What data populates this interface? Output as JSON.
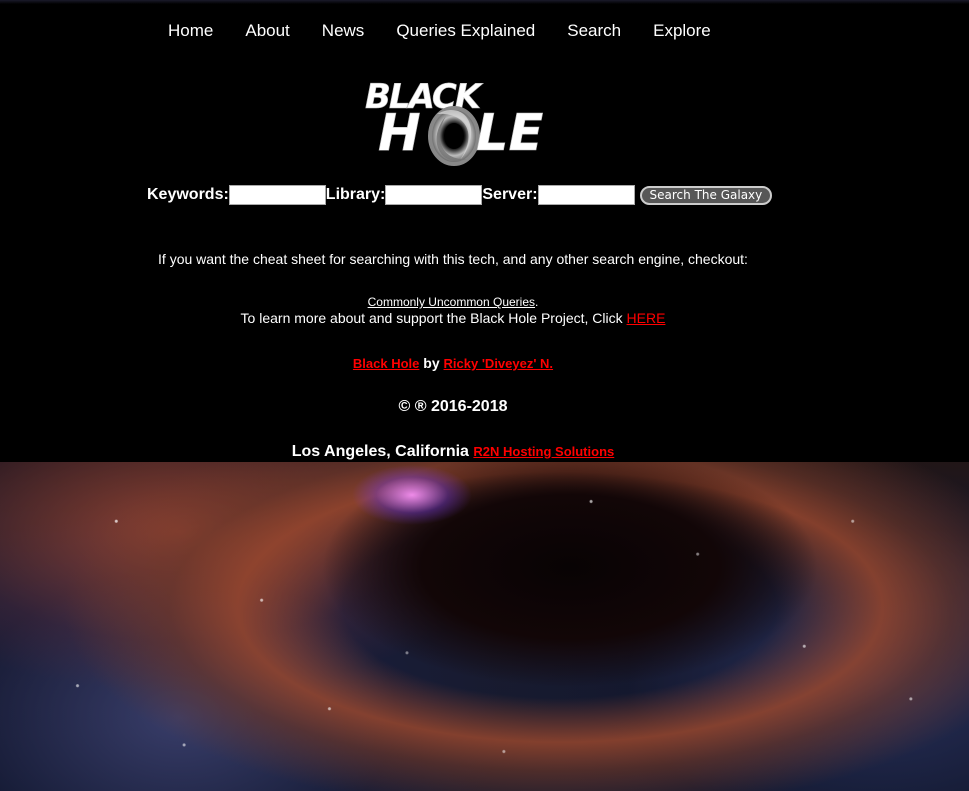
{
  "nav": {
    "items": [
      {
        "label": "Home"
      },
      {
        "label": "About"
      },
      {
        "label": "News"
      },
      {
        "label": "Queries Explained"
      },
      {
        "label": "Search"
      },
      {
        "label": "Explore"
      }
    ]
  },
  "logo": {
    "line1": "BLACK",
    "line2_left": "H",
    "line2_right": "LE",
    "icon": "black-hole-swirl"
  },
  "search": {
    "keywords_label": "Keywords:",
    "keywords_value": "",
    "library_label": "Library:",
    "library_value": "",
    "server_label": "Server:",
    "server_value": "",
    "button_label": "Search The Galaxy"
  },
  "content": {
    "cheat_sheet_text": "If you want the cheat sheet for searching with this tech, and any other search engine, checkout:",
    "common_queries_link": "Commonly Uncommon Queries",
    "common_queries_period": ".",
    "learn_text": "To learn more about and support the Black Hole Project, Click ",
    "learn_link": "HERE",
    "project_link": "Black Hole",
    "by_text": " by ",
    "author_link": "Ricky 'Diveyez' N.",
    "copyright": "© ® 2016-2018",
    "location_text": "Los Angeles, California ",
    "hosting_link": "R2N Hosting Solutions"
  },
  "colors": {
    "background": "#000000",
    "text": "#ffffff",
    "link": "#ff0000",
    "button": "#575757"
  }
}
